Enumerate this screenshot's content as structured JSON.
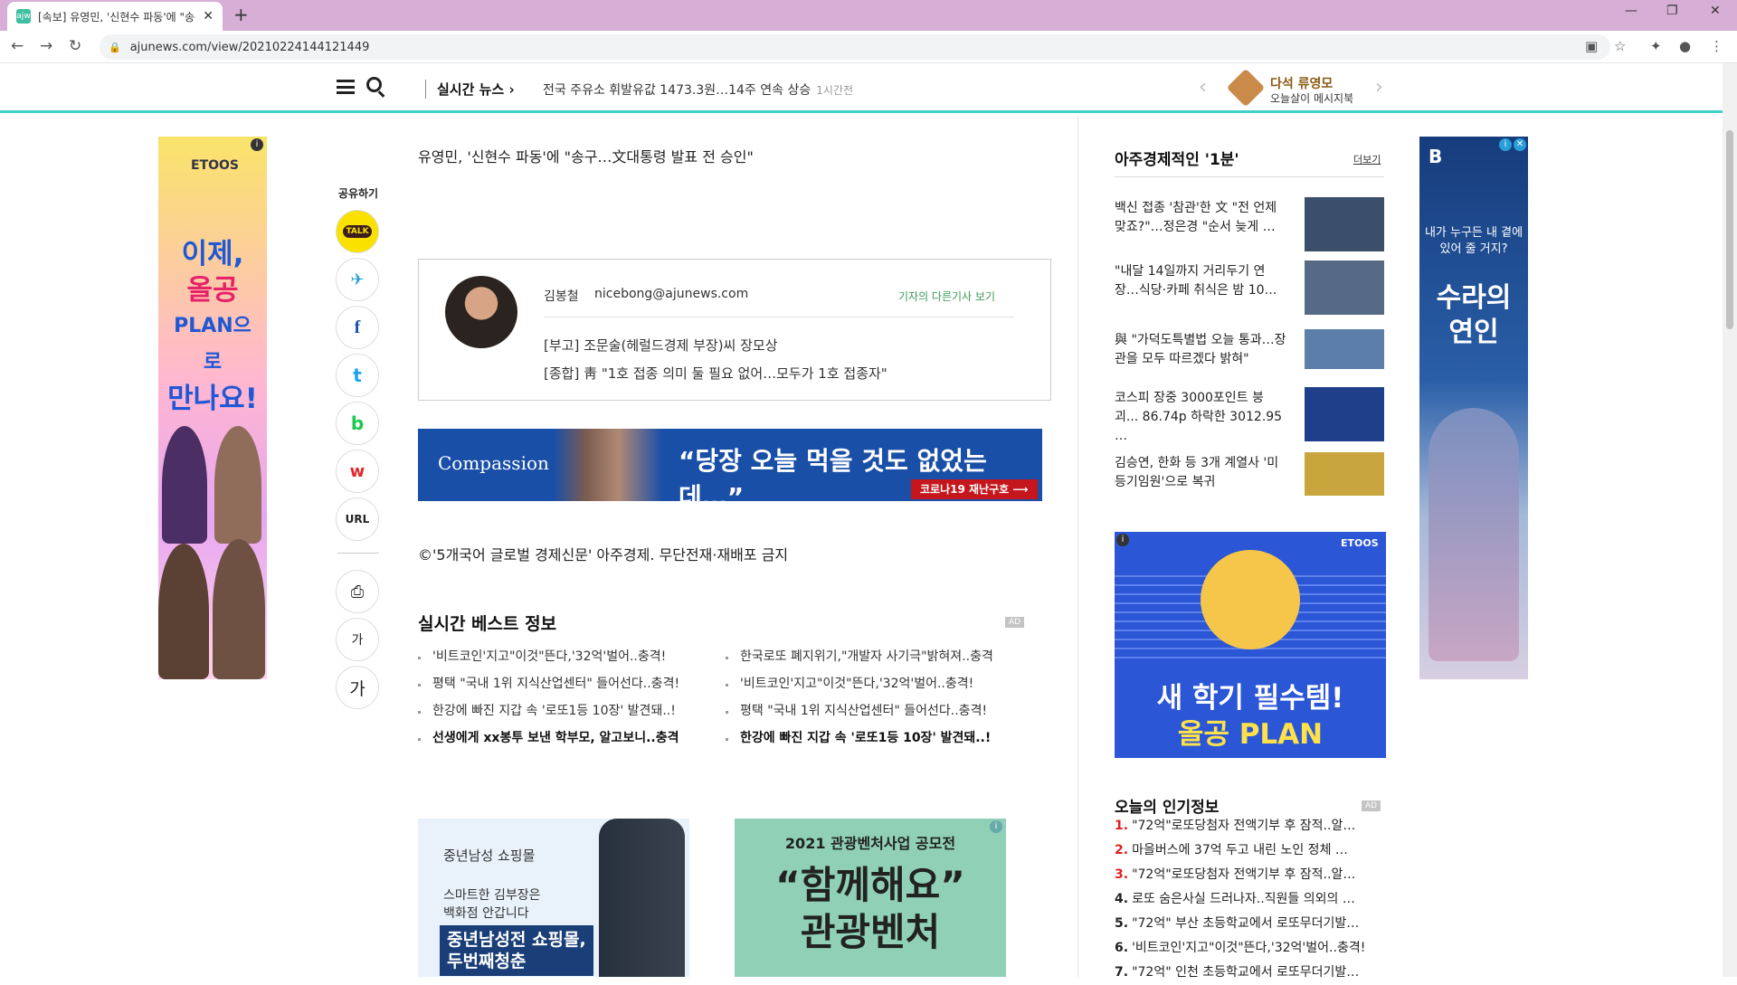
{
  "browser": {
    "tab_title": "[속보] 유영민, '신현수 파동'에 \"송구…",
    "url": "ajunews.com/view/20210224144121449"
  },
  "site_nav": {
    "live_news_label": "실시간 뉴스",
    "ticker_text": "전국 주유소 휘발유값 1473.3원…14주 연속 상승",
    "ticker_time": "1시간전",
    "column_name": "다석 류영모",
    "column_sub": "오늘살이 메시지북"
  },
  "left_ad": {
    "brand": "ETOOS",
    "line1": "이제,",
    "line2": "올공",
    "line3": "PLAN으로",
    "line4": "만나요!"
  },
  "share": {
    "label": "공유하기",
    "buttons": [
      "TALK",
      "✈",
      "f",
      "t",
      "b",
      "w",
      "URL"
    ],
    "print_icon": "⎙",
    "font_small": "가",
    "font_large": "가"
  },
  "article": {
    "headline": "유영민, '신현수 파동'에 \"송구…文대통령 발표 전 승인\"",
    "reporter_name": "김봉철",
    "reporter_email": "nicebong@ajunews.com",
    "reporter_more": "기자의 다른기사 보기",
    "reporter_articles": [
      "[부고] 조문술(헤럴드경제 부장)씨 장모상",
      "[종합] 靑 \"1호 접종 의미 둘 필요 없어…모두가 1호 접종자\""
    ],
    "banner_logo": "Compassion",
    "banner_text": "“당장 오늘 먹을 것도 없었는데…”",
    "banner_tag": "코로나19 재난구호 ⟶",
    "copyright": "©'5개국어 글로벌 경제신문' 아주경제. 무단전재·재배포 금지"
  },
  "best": {
    "title": "실시간 베스트 정보",
    "ad_label": "AD",
    "left": [
      "'비트코인'지고\"이것\"뜬다,'32억'벌어..충격!",
      "평택 \"국내 1위 지식산업센터\" 들어선다..충격!",
      "한강에 빠진 지갑 속 '로또1등 10장' 발견돼..!",
      "선생에게 xx봉투 보낸 학부모, 알고보니..충격"
    ],
    "right": [
      "한국로또 폐지위기,\"개발자 사기극\"밝혀져..충격",
      "'비트코인'지고\"이것\"뜬다,'32억'벌어..충격!",
      "평택 \"국내 1위 지식산업센터\" 들어선다..충격!",
      "한강에 빠진 지갑 속 '로또1등 10장' 발견돼..!"
    ]
  },
  "bottom_ads": {
    "ad1_brand": "중년남성 쇼핑몰",
    "ad1_sub1": "스마트한 김부장은",
    "ad1_sub2": "백화점 안갑니다",
    "ad1_big1": "중년남성전 쇼핑몰,",
    "ad1_big2": "두번째청춘",
    "ad2_title": "2021 관광벤처사업 공모전",
    "ad2_big1": "“함께해요”",
    "ad2_big2": "관광벤처"
  },
  "sidebar": {
    "title": "아주경제적인 '1분'",
    "more": "더보기",
    "news": [
      {
        "text": "백신 접종 '참관'한 文 \"전 언제 맞죠?\"…정은경 \"순서 늦게 …",
        "thumb": "#3b4f6b"
      },
      {
        "text": "\"내달 14일까지 거리두기 연장…식당·카페 취식은 밤 10…",
        "thumb": "#566a85"
      },
      {
        "text": "與 \"가덕도특별법 오늘 통과…장관을 모두 따르겠다 밝혀\"",
        "thumb": "#5c7faa"
      },
      {
        "text": "코스피 장중 3000포인트 붕괴... 86.74p 하락한 3012.95 …",
        "thumb": "#1f3f8a"
      },
      {
        "text": "김승연, 한화 등 3개 계열사 '미등기임원'으로 복귀",
        "thumb": "#c9a63d"
      }
    ],
    "ad_brand": "ETOOS",
    "ad_line1": "새 학기 필수템!",
    "ad_line2": "올공 PLAN",
    "popular_title": "오늘의 인기정보",
    "popular_ad": "AD",
    "popular": [
      {
        "n": "1.",
        "text": "\"72억\"로또당첨자 전액기부 후 잠적..알…",
        "red": true
      },
      {
        "n": "2.",
        "text": "마을버스에 37억 두고 내린 노인 정체 …",
        "red": true
      },
      {
        "n": "3.",
        "text": "\"72억\"로또당첨자 전액기부 후 잠적..알…",
        "red": true
      },
      {
        "n": "4.",
        "text": "로또 숨은사실 드러나자..직원들 의외의 …",
        "red": false
      },
      {
        "n": "5.",
        "text": "\"72억\" 부산 초등학교에서 로또무더기발…",
        "red": false
      },
      {
        "n": "6.",
        "text": "'비트코인'지고\"이것\"뜬다,'32억'벌어..충격!",
        "red": false
      },
      {
        "n": "7.",
        "text": "\"72억\" 인천 초등학교에서 로또무더기발…",
        "red": false
      }
    ]
  },
  "right_ad": {
    "brand": "B",
    "sub": "내가 누구든 내 곁에 있어 줄 거지?",
    "title": "수라의 연인"
  },
  "colors": {
    "accent": "#3fd1c5",
    "tabbar": "#d7aed6",
    "banner": "#1a4fa8"
  }
}
